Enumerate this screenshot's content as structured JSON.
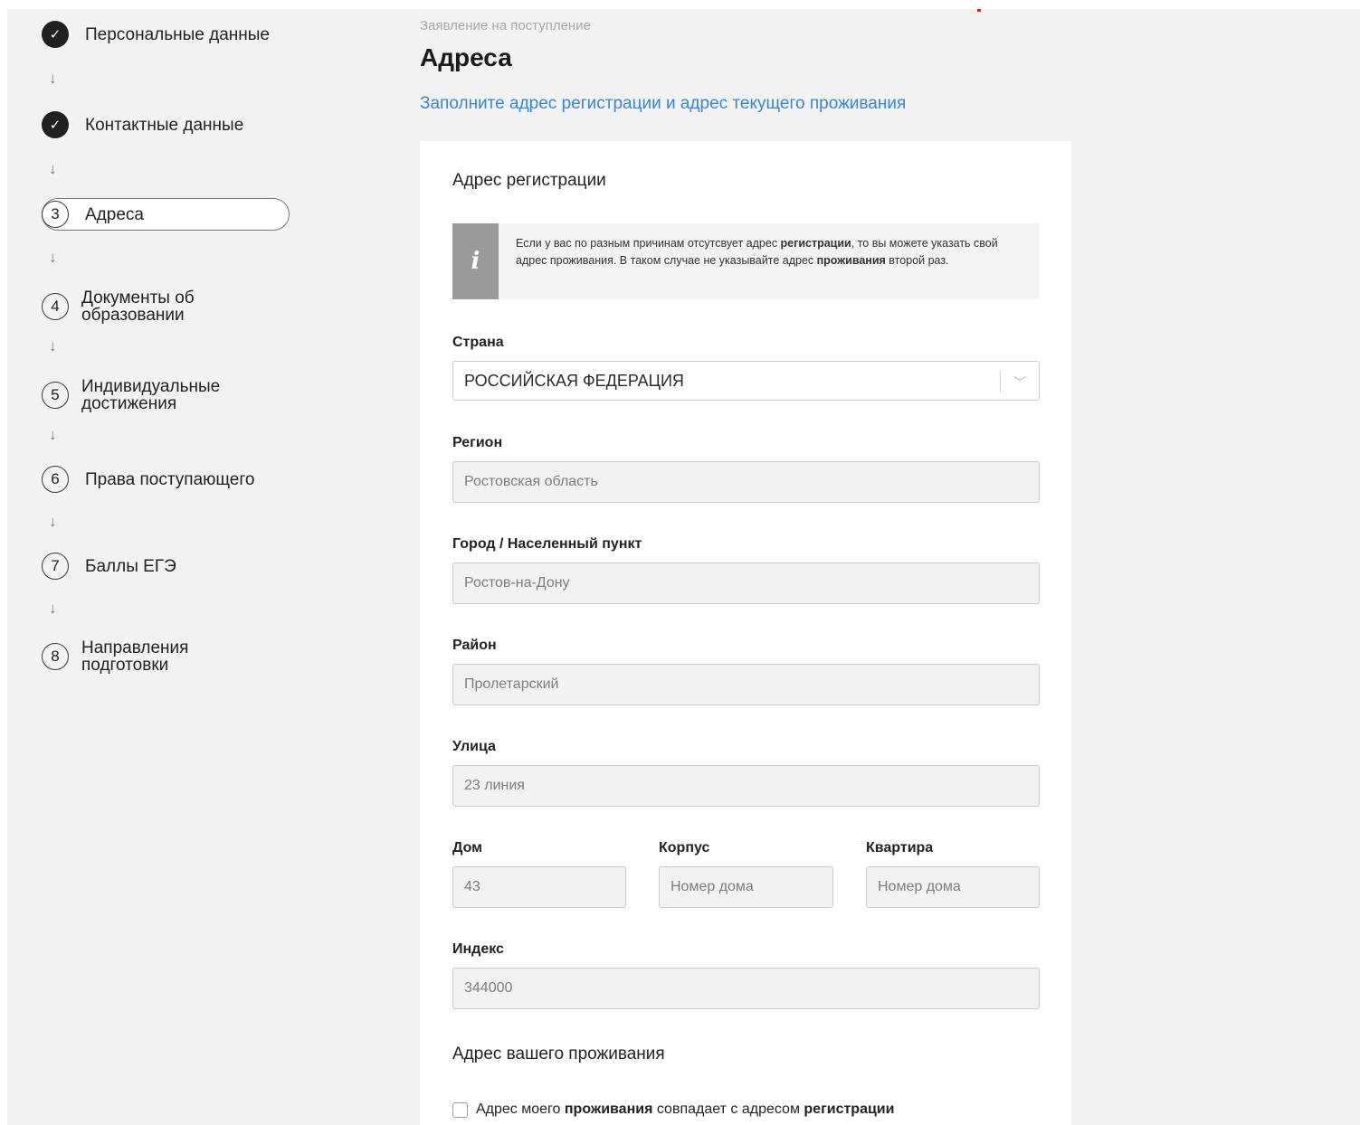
{
  "sidebar": {
    "steps": [
      {
        "marker": "✓",
        "label": "Персональные данные"
      },
      {
        "marker": "✓",
        "label": "Контактные данные"
      },
      {
        "marker": "3",
        "label": "Адреса"
      },
      {
        "marker": "4",
        "label": "Документы об образовании"
      },
      {
        "marker": "5",
        "label": "Индивидуальные достижения"
      },
      {
        "marker": "6",
        "label": "Права поступающего"
      },
      {
        "marker": "7",
        "label": "Баллы ЕГЭ"
      },
      {
        "marker": "8",
        "label": "Направления подготовки"
      }
    ],
    "arrow": "↓"
  },
  "header": {
    "breadcrumb": "Заявление на поступление",
    "title": "Адреса",
    "subtitle": "Заполните адрес регистрации и адрес текущего проживания"
  },
  "form": {
    "registration_title": "Адрес регистрации",
    "info": {
      "icon": "info-icon",
      "glyph": "i",
      "part1": "Если у вас по разным причинам отсутсвует адрес ",
      "bold1": "регистрации",
      "part2": ", то вы можете указать свой адрес проживания. В таком случае не указывайте адрес ",
      "bold2": "проживания",
      "part3": " второй раз."
    },
    "country": {
      "label": "Страна",
      "value": "РОССИЙСКАЯ ФЕДЕРАЦИЯ"
    },
    "region": {
      "label": "Регион",
      "value": "Ростовская область"
    },
    "city": {
      "label": "Город / Населенный пункт",
      "value": "Ростов-на-Дону"
    },
    "district": {
      "label": "Район",
      "value": "Пролетарский"
    },
    "street": {
      "label": "Улица",
      "value": "23 линия"
    },
    "house": {
      "label": "Дом",
      "value": "43"
    },
    "building": {
      "label": "Корпус",
      "placeholder": "Номер дома"
    },
    "apartment": {
      "label": "Квартира",
      "placeholder": "Номер дома"
    },
    "postcode": {
      "label": "Индекс",
      "value": "344000"
    },
    "residence_title": "Адрес вашего проживания",
    "same_address": {
      "part1": "Адрес моего ",
      "bold1": "проживания",
      "part2": " совпадает с адресом ",
      "bold2": "регистрации",
      "checked": false
    }
  },
  "colors": {
    "accent_link": "#3a86d6",
    "done_step": "#202020",
    "brand_mark": "#e31e24"
  }
}
